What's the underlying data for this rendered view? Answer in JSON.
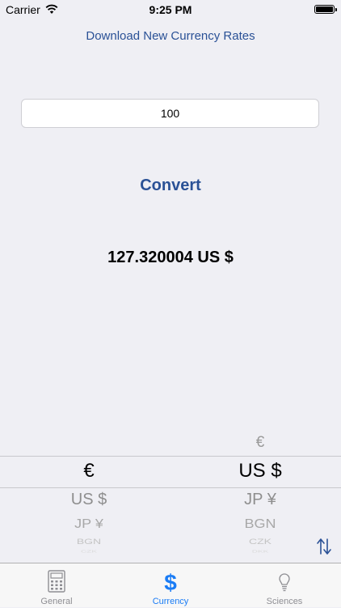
{
  "status": {
    "carrier": "Carrier",
    "time": "9:25 PM",
    "battery_level": 1.0
  },
  "download_link": "Download New Currency Rates",
  "amount_input": {
    "value": "100"
  },
  "convert_label": "Convert",
  "result": "127.320004 US $",
  "picker": {
    "from": {
      "selected": "€",
      "below": [
        "US $",
        "JP ¥",
        "BGN",
        "CZK"
      ]
    },
    "to": {
      "above": "€",
      "selected": "US $",
      "below": [
        "JP ¥",
        "BGN",
        "CZK",
        "DKK"
      ]
    }
  },
  "tabs": [
    {
      "label": "General",
      "icon": "calculator-icon",
      "active": false
    },
    {
      "label": "Currency",
      "icon": "dollar-icon",
      "active": true
    },
    {
      "label": "Sciences",
      "icon": "lightbulb-icon",
      "active": false
    }
  ],
  "colors": {
    "accent": "#2a5196",
    "tab_active": "#1a7cf5",
    "tab_inactive": "#8e8e93",
    "background": "#efeff4"
  }
}
